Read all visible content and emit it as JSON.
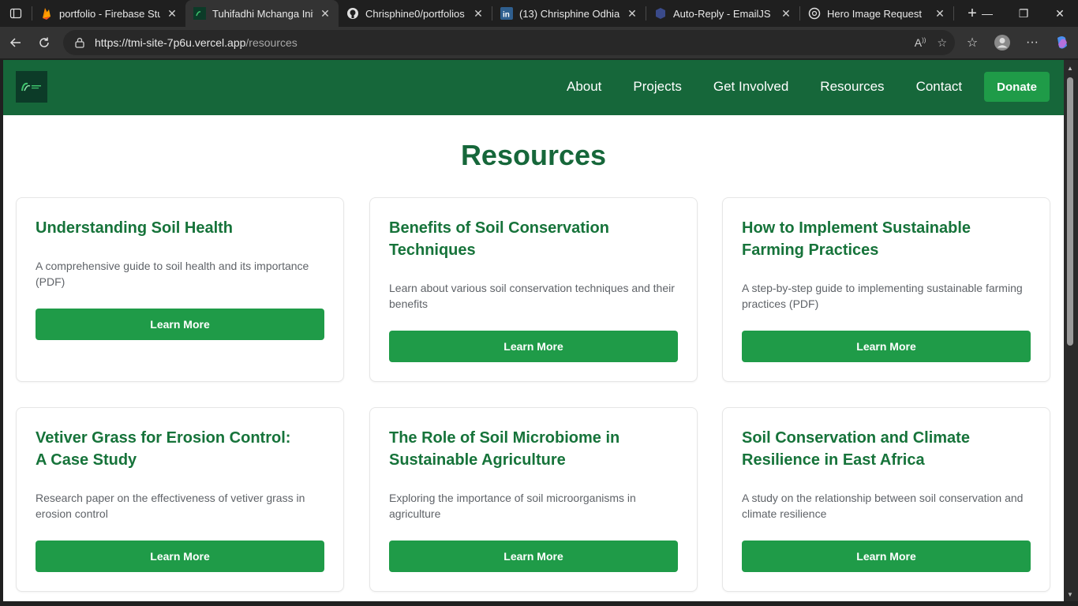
{
  "browser": {
    "tabs": [
      {
        "title": "portfolio - Firebase Stu",
        "icon": "firebase-icon"
      },
      {
        "title": "Tuhifadhi Mchanga Init",
        "icon": "site-favicon",
        "active": true
      },
      {
        "title": "Chrisphine0/portfolios",
        "icon": "github-icon"
      },
      {
        "title": "(13) Chrisphine Odhiam",
        "icon": "linkedin-icon"
      },
      {
        "title": "Auto-Reply - EmailJS",
        "icon": "emailjs-icon"
      },
      {
        "title": "Hero Image Request",
        "icon": "chatgpt-icon"
      }
    ],
    "url_host": "https://tmi-site-7p6u.vercel.app",
    "url_path": "/resources"
  },
  "nav": {
    "items": [
      "About",
      "Projects",
      "Get Involved",
      "Resources",
      "Contact"
    ],
    "donate": "Donate"
  },
  "page_title": "Resources",
  "cards": [
    {
      "title": "Understanding Soil Health",
      "description": "A comprehensive guide to soil health and its importance (PDF)",
      "button": "Learn More"
    },
    {
      "title": "Benefits of Soil Conservation Techniques",
      "description": "Learn about various soil conservation techniques and their benefits",
      "button": "Learn More"
    },
    {
      "title": "How to Implement Sustainable Farming Practices",
      "description": "A step-by-step guide to implementing sustainable farming practices (PDF)",
      "button": "Learn More"
    },
    {
      "title": "Vetiver Grass for Erosion Control: A Case Study",
      "description": "Research paper on the effectiveness of vetiver grass in erosion control",
      "button": "Learn More"
    },
    {
      "title": "The Role of Soil Microbiome in Sustainable Agriculture",
      "description": "Exploring the importance of soil microorganisms in agriculture",
      "button": "Learn More"
    },
    {
      "title": "Soil Conservation and Climate Resilience in East Africa",
      "description": "A study on the relationship between soil conservation and climate resilience",
      "button": "Learn More"
    }
  ],
  "colors": {
    "header_bg": "#16673a",
    "accent": "#1f9b48",
    "title": "#16673a"
  }
}
